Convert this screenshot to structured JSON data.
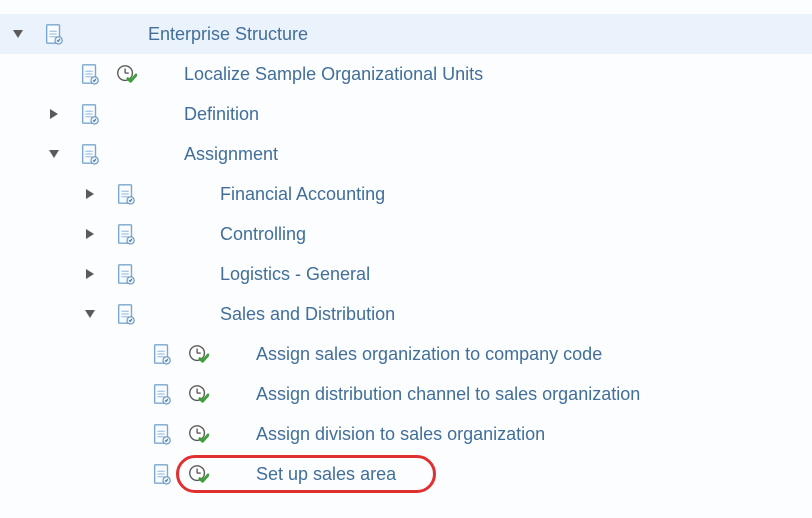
{
  "tree": {
    "root": {
      "label": "Enterprise Structure",
      "expanded": true,
      "children": [
        {
          "key": "localize",
          "label": "Localize Sample Organizational Units",
          "activity": true
        },
        {
          "key": "definition",
          "label": "Definition",
          "expanded": false
        },
        {
          "key": "assignment",
          "label": "Assignment",
          "expanded": true,
          "children": [
            {
              "key": "fi",
              "label": "Financial Accounting",
              "expanded": false
            },
            {
              "key": "co",
              "label": "Controlling",
              "expanded": false
            },
            {
              "key": "log",
              "label": "Logistics - General",
              "expanded": false
            },
            {
              "key": "sd",
              "label": "Sales and Distribution",
              "expanded": true,
              "children": [
                {
                  "key": "sorg_cc",
                  "label": "Assign sales organization to company code",
                  "activity": true
                },
                {
                  "key": "dc_sorg",
                  "label": "Assign distribution channel to sales organization",
                  "activity": true
                },
                {
                  "key": "div_sorg",
                  "label": "Assign division to sales organization",
                  "activity": true
                },
                {
                  "key": "sales_area",
                  "label": "Set up sales area",
                  "activity": true,
                  "highlighted": true
                }
              ]
            }
          ]
        }
      ]
    }
  }
}
